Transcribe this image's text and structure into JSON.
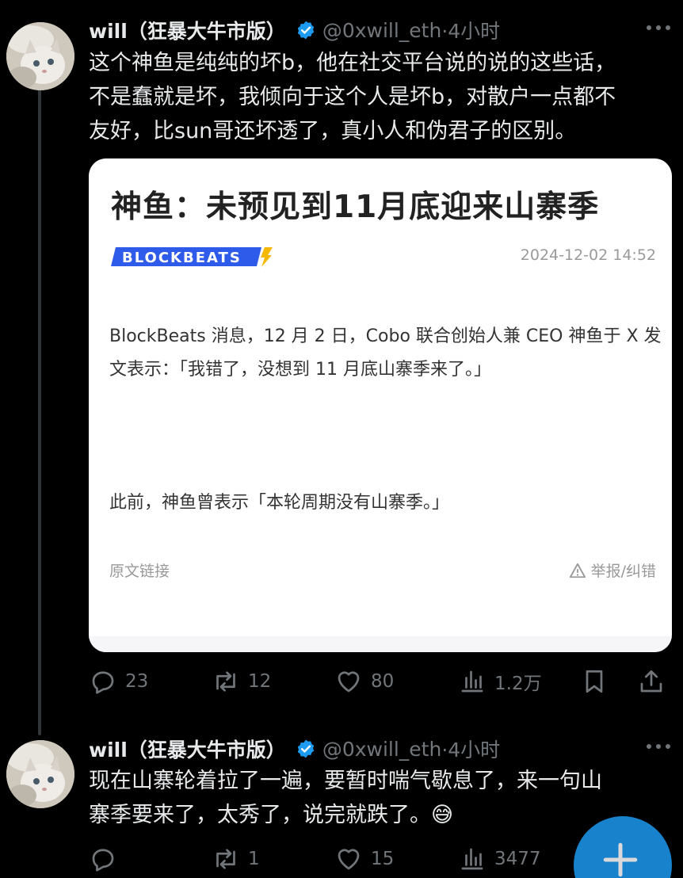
{
  "tweet1": {
    "name": "will（狂暴大牛市版）",
    "handle": "@0xwill_eth",
    "time": "·4小时",
    "text": "这个神鱼是纯纯的坏b，他在社交平台说的说的这些话，\n不是蠢就是坏，我倾向于这个人是坏b，对散户一点都不\n友好，比sun哥还坏透了，真小人和伪君子的区别。",
    "card": {
      "title": "神鱼：未预见到11月底迎来山寨季",
      "source": "BLOCKBEATS",
      "date": "2024-12-02 14:52",
      "body": "BlockBeats 消息，12 月 2 日，Cobo 联合创始人兼 CEO 神鱼于 X 发文表示：「我错了，没想到 11 月底山寨季来了。」",
      "body2": "此前，神鱼曾表示「本轮周期没有山寨季。」",
      "link": "原文链接",
      "report": "举报/纠错"
    },
    "replies": "23",
    "reposts": "12",
    "likes": "80",
    "views": "1.2万"
  },
  "tweet2": {
    "name": "will（狂暴大牛市版）",
    "handle": "@0xwill_eth",
    "time": "·4小时",
    "text": "现在山寨轮着拉了一遍，要暂时喘气歇息了，来一句山\n寨季要来了，太秀了，说完就跌了。😅",
    "replies": "",
    "reposts": "1",
    "likes": "15",
    "views": "3477"
  },
  "icons": {
    "verified": "verified-badge-icon",
    "reply": "reply-icon",
    "repost": "repost-icon",
    "like": "heart-icon",
    "views": "analytics-icon",
    "bookmark": "bookmark-icon",
    "share": "share-icon",
    "compose": "compose-plus-icon"
  },
  "colors": {
    "background": "#000000",
    "text": "#e7e9ea",
    "muted": "#71767b",
    "accent": "#1d9bf0"
  }
}
